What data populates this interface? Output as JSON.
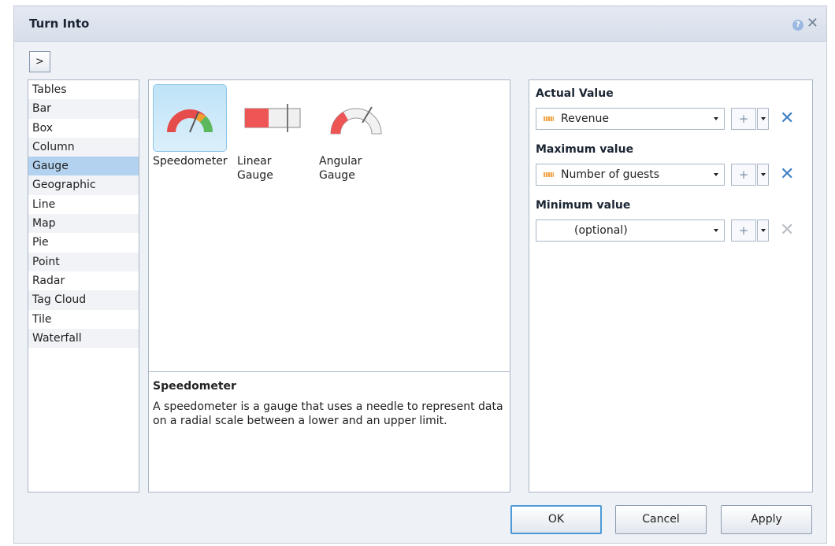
{
  "dialog": {
    "title": "Turn Into",
    "help_icon": "help-icon",
    "close_icon": "close-icon",
    "toggle_label": ">"
  },
  "categories": [
    "Tables",
    "Bar",
    "Box",
    "Column",
    "Gauge",
    "Geographic",
    "Line",
    "Map",
    "Pie",
    "Point",
    "Radar",
    "Tag Cloud",
    "Tile",
    "Waterfall"
  ],
  "selected_category": "Gauge",
  "visualizations": [
    {
      "label": "Speedometer",
      "icon": "speedometer-icon",
      "selected": true
    },
    {
      "label": "Linear Gauge",
      "icon": "linear-gauge-icon",
      "selected": false
    },
    {
      "label": "Angular Gauge",
      "icon": "angular-gauge-icon",
      "selected": false
    }
  ],
  "description": {
    "title": "Speedometer",
    "text": "A speedometer is a gauge that uses a needle to represent data on a radial scale between a lower and an upper limit."
  },
  "feeds": [
    {
      "label": "Actual Value",
      "value": "Revenue",
      "icon": "measure-icon",
      "removable": true
    },
    {
      "label": "Maximum value",
      "value": "Number of guests",
      "icon": "measure-icon",
      "removable": true
    },
    {
      "label": "Minimum value",
      "value": "(optional)",
      "icon": "",
      "removable": false
    }
  ],
  "feed_controls": {
    "plus": "+",
    "remove": "✕"
  },
  "buttons": {
    "ok": "OK",
    "cancel": "Cancel",
    "apply": "Apply"
  },
  "colors": {
    "selection": "#b3d2ef",
    "accent": "#3d7fc5",
    "gauge_red": "#e74c4c",
    "gauge_green": "#5cb85c",
    "gauge_orange": "#f0a030"
  }
}
